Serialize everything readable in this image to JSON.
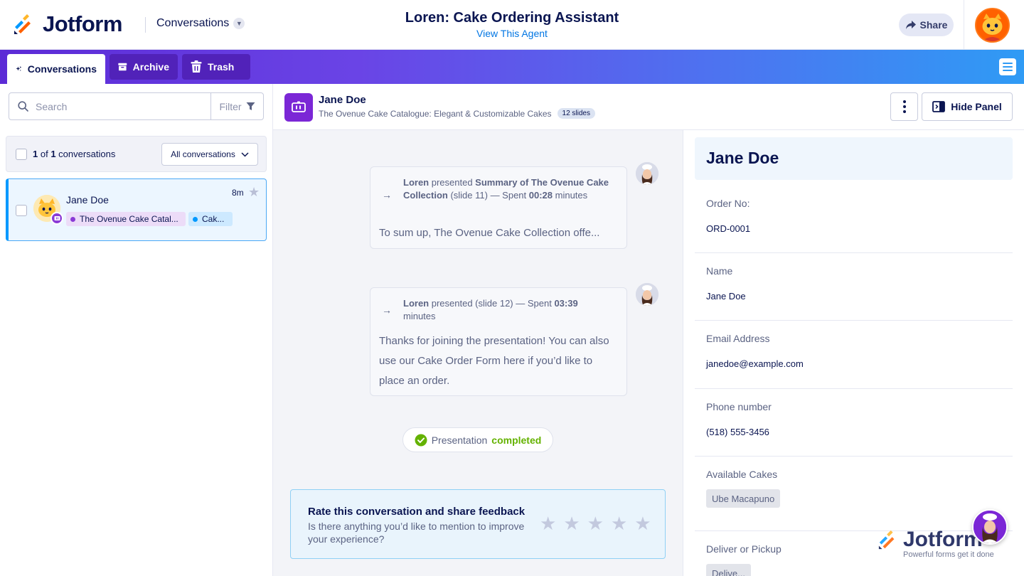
{
  "brand": {
    "name": "Jotform",
    "tagline": "Powerful forms get it done"
  },
  "header": {
    "section_label": "Conversations",
    "agent_title": "Loren: Cake Ordering Assistant",
    "agent_link": "View This Agent",
    "share_label": "Share"
  },
  "tabs": [
    {
      "label": "Conversations",
      "active": true
    },
    {
      "label": "Archive",
      "active": false
    },
    {
      "label": "Trash",
      "active": false
    }
  ],
  "sidebar": {
    "search_placeholder": "Search",
    "filter_label": "Filter",
    "count_current": "1",
    "count_of": " of ",
    "count_total": "1",
    "count_suffix": " conversations",
    "scope_label": "All conversations",
    "conversations": [
      {
        "name": "Jane Doe",
        "time": "8m",
        "chips": [
          "The Ovenue Cake Catal...",
          "Cak..."
        ]
      }
    ]
  },
  "chat": {
    "contact_name": "Jane Doe",
    "document_title": "The Ovenue Cake Catalogue: Elegant & Customizable Cakes",
    "slides_badge": "12 slides",
    "hide_panel_label": "Hide Panel",
    "messages": [
      {
        "actor": "Loren",
        "verb": " presented ",
        "slide_title": "Summary of The Ovenue Cake Collection",
        "slide_ref": " (slide 11) — Spent ",
        "duration": "00:28",
        "unit": " minutes",
        "body": "To sum up, The Ovenue Cake Collection offe..."
      },
      {
        "actor": "Loren",
        "verb": " presented ",
        "slide_title": "",
        "slide_ref": "(slide 12) — Spent ",
        "duration": "03:39",
        "unit": " minutes",
        "body": "Thanks for joining the presentation! You can also use our Cake Order Form here if you’d like to place an order."
      }
    ],
    "status_prefix": "Presentation ",
    "status_value": "completed",
    "rating": {
      "title": "Rate this conversation and share feedback",
      "subtitle": "Is there anything you’d like to mention to improve your experience?",
      "stars_max": 5,
      "stars_selected": 0
    }
  },
  "panel": {
    "title": "Jane Doe",
    "fields": [
      {
        "label": "Order No:",
        "value": "ORD-0001"
      },
      {
        "label": "Name",
        "value": "Jane Doe"
      },
      {
        "label": "Email Address",
        "value": "janedoe@example.com"
      },
      {
        "label": "Phone number",
        "value": "(518) 555-3456"
      },
      {
        "label": "Available Cakes",
        "value": "Ube Macapuno"
      },
      {
        "label": "Deliver or Pickup",
        "value": "Delive..."
      }
    ]
  },
  "colors": {
    "navy": "#0a1551",
    "accent_blue": "#0099ff",
    "purple": "#7b27d6",
    "success_green": "#64b200",
    "orange": "#ff6100"
  },
  "icons": [
    "jotform-logo-icon",
    "chevron-down-icon",
    "share-arrow-icon",
    "sparkle-icon",
    "archive-icon",
    "trash-icon",
    "hamburger-menu-icon",
    "search-icon",
    "filter-funnel-icon",
    "star-icon",
    "presentation-icon",
    "kebab-menu-icon",
    "hide-panel-icon",
    "arrow-right-icon",
    "check-circle-icon"
  ]
}
